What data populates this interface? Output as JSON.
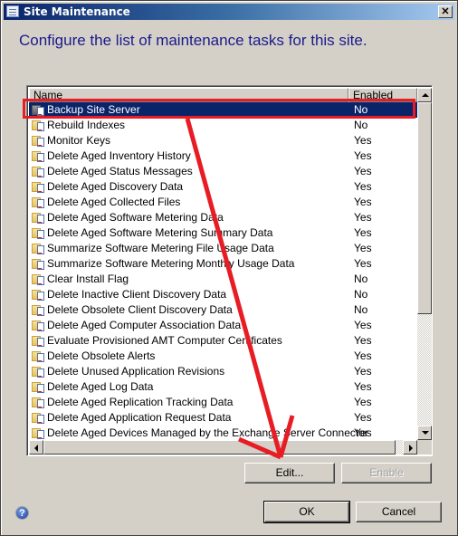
{
  "window": {
    "title": "Site Maintenance",
    "close_label": "✕"
  },
  "heading": "Configure the list of maintenance tasks for this site.",
  "list": {
    "columns": [
      "Name",
      "Enabled"
    ],
    "rows": [
      {
        "name": "Backup Site Server",
        "enabled": "No",
        "selected": true
      },
      {
        "name": "Rebuild Indexes",
        "enabled": "No"
      },
      {
        "name": "Monitor Keys",
        "enabled": "Yes"
      },
      {
        "name": "Delete Aged Inventory History",
        "enabled": "Yes"
      },
      {
        "name": "Delete Aged Status Messages",
        "enabled": "Yes"
      },
      {
        "name": "Delete Aged Discovery Data",
        "enabled": "Yes"
      },
      {
        "name": "Delete Aged Collected Files",
        "enabled": "Yes"
      },
      {
        "name": "Delete Aged Software Metering Data",
        "enabled": "Yes"
      },
      {
        "name": "Delete Aged Software Metering Summary Data",
        "enabled": "Yes"
      },
      {
        "name": "Summarize Software Metering File Usage Data",
        "enabled": "Yes"
      },
      {
        "name": "Summarize Software Metering Monthly Usage Data",
        "enabled": "Yes"
      },
      {
        "name": "Clear Install Flag",
        "enabled": "No"
      },
      {
        "name": "Delete Inactive Client Discovery Data",
        "enabled": "No"
      },
      {
        "name": "Delete Obsolete Client Discovery Data",
        "enabled": "No"
      },
      {
        "name": "Delete Aged Computer Association Data",
        "enabled": "Yes"
      },
      {
        "name": "Evaluate Provisioned AMT Computer Certificates",
        "enabled": "Yes"
      },
      {
        "name": "Delete Obsolete Alerts",
        "enabled": "Yes"
      },
      {
        "name": "Delete Unused Application Revisions",
        "enabled": "Yes"
      },
      {
        "name": "Delete Aged Log Data",
        "enabled": "Yes"
      },
      {
        "name": "Delete Aged Replication Tracking Data",
        "enabled": "Yes"
      },
      {
        "name": "Delete Aged Application Request Data",
        "enabled": "Yes"
      },
      {
        "name": "Delete Aged Devices Managed by the Exchange Server Connector",
        "enabled": "Yes"
      }
    ]
  },
  "buttons": {
    "edit": "Edit...",
    "enable": "Enable",
    "ok": "OK",
    "cancel": "Cancel",
    "help": "?"
  },
  "annotation": {
    "color": "#e81c24"
  }
}
